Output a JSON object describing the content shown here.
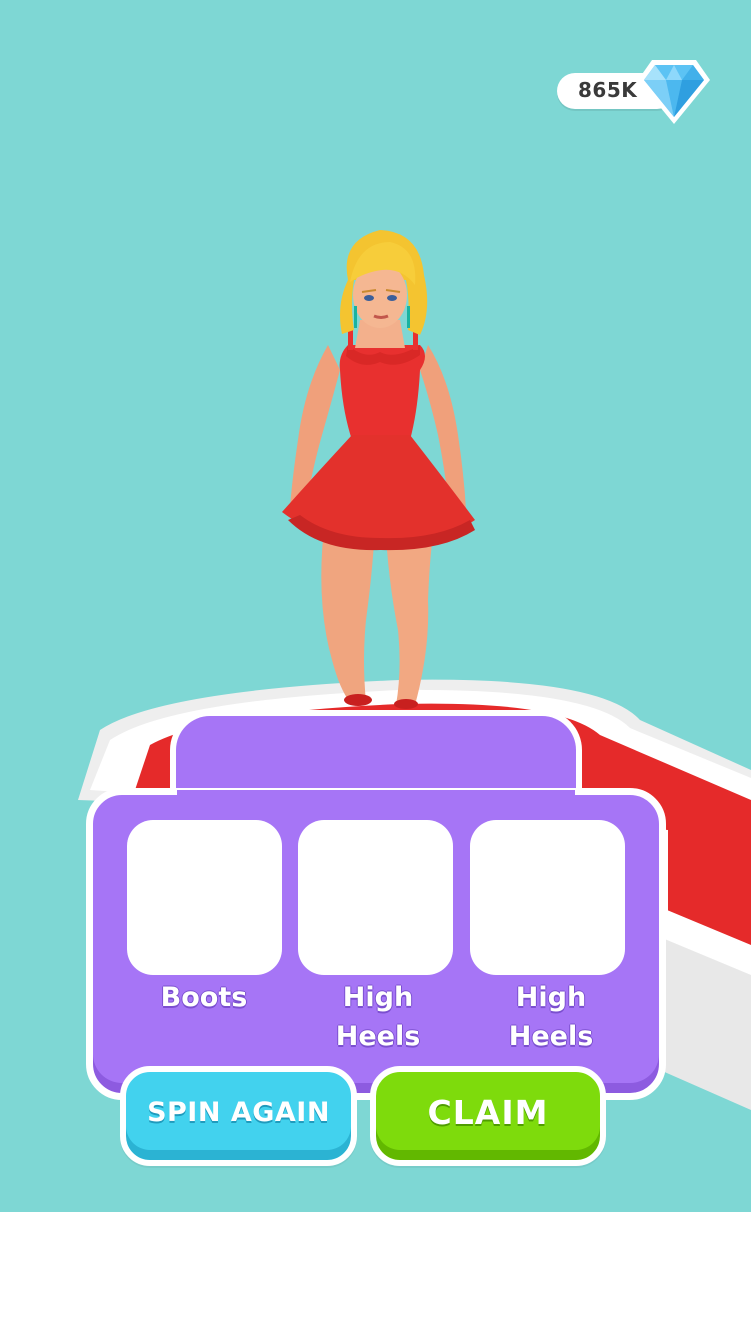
{
  "hud": {
    "gems": "865K",
    "gem_icon": "diamond-icon"
  },
  "reward_panel": {
    "slots": [
      {
        "label": "Boots"
      },
      {
        "label": "High\nHeels"
      },
      {
        "label": "High\nHeels"
      }
    ]
  },
  "buttons": {
    "spin_again": "SPIN AGAIN",
    "claim": "CLAIM"
  },
  "colors": {
    "background": "#7ed7d4",
    "panel": "#a675f6",
    "spin_button": "#42d2ee",
    "claim_button": "#7edb0c",
    "dress": "#e8302f"
  }
}
